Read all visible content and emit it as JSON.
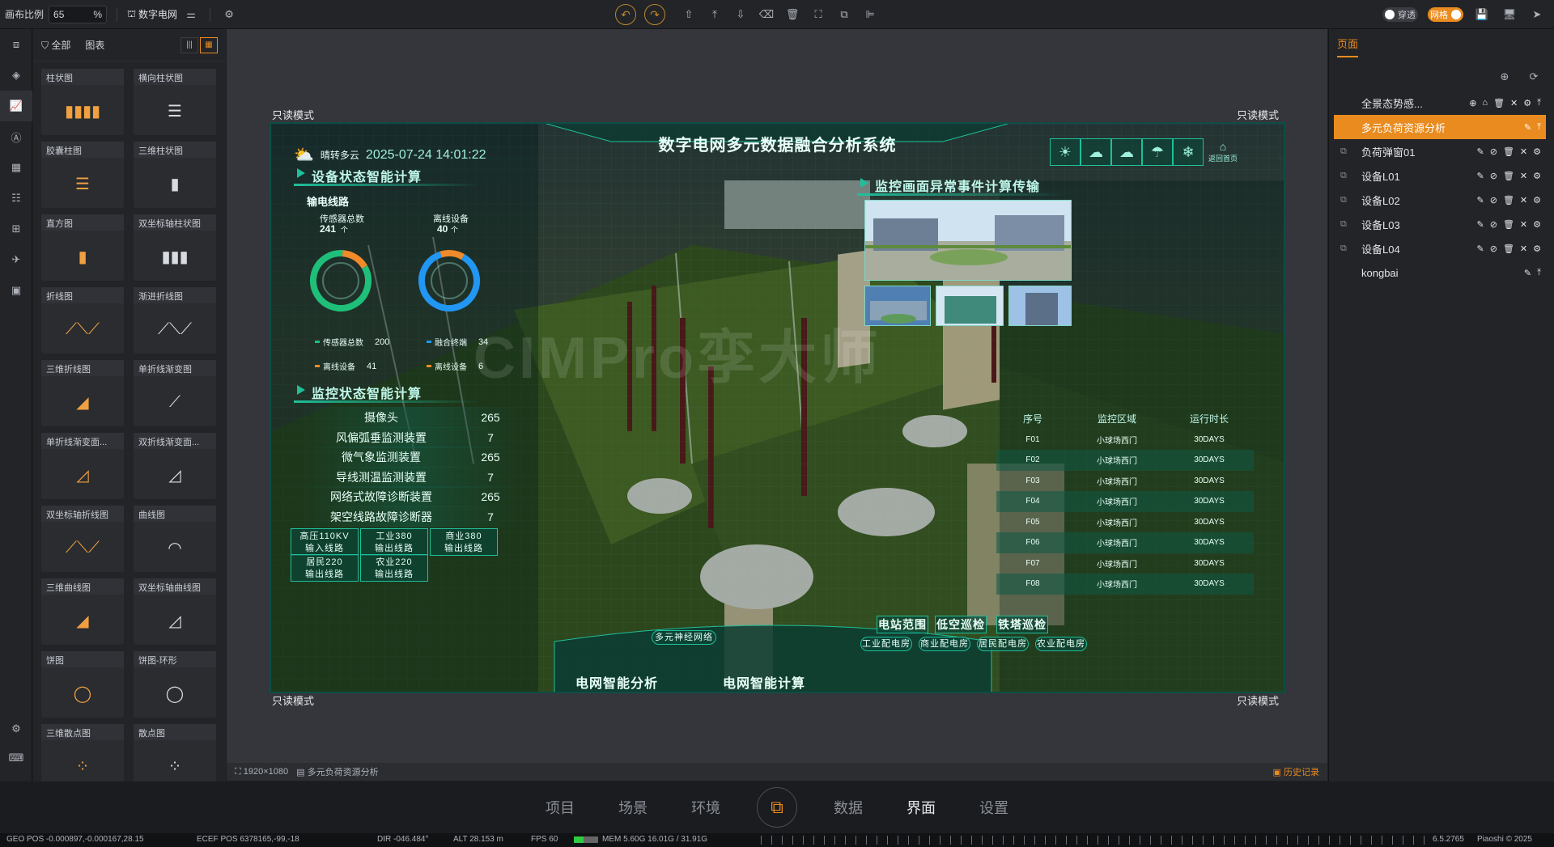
{
  "toolbar": {
    "zoom_label": "画布比例",
    "zoom_value": "65",
    "zoom_unit": "%",
    "project_name": "数字电网",
    "toggle_through": "穿透",
    "toggle_grid": "网格"
  },
  "library": {
    "tab_all": "全部",
    "tab_charts": "图表",
    "cards": [
      "柱状图",
      "横向柱状图",
      "胶囊柱图",
      "三维柱状图",
      "直方图",
      "双坐标轴柱状图",
      "折线图",
      "渐进折线图",
      "三维折线图",
      "单折线渐变图",
      "单折线渐变面...",
      "双折线渐变面...",
      "双坐标轴折线图",
      "曲线图",
      "三维曲线图",
      "双坐标轴曲线图",
      "饼图",
      "饼图-环形",
      "三维散点图",
      "散点图"
    ]
  },
  "stage": {
    "readonly": "只读模式",
    "footer_size": "1920×1080",
    "footer_page": "多元负荷资源分析",
    "history": "历史记录"
  },
  "dashboard": {
    "title": "数字电网多元数据融合分析系统",
    "weather": "晴转多云",
    "datetime": "2025-07-24 14:01:22",
    "sec1": "设备状态智能计算",
    "sub1": "输电线路",
    "sensor_label": "传感器总数",
    "sensor_value": "241",
    "sensor_unit": "个",
    "offline_label": "离线设备",
    "offline_value": "40",
    "offline_unit": "个",
    "legend": [
      {
        "label": "传感器总数",
        "value": "200",
        "color": "#1fbf7a"
      },
      {
        "label": "融合终端",
        "value": "34",
        "color": "#2196f3"
      },
      {
        "label": "离线设备",
        "value": "41",
        "color": "#f08a2a"
      },
      {
        "label": "离线设备",
        "value": "6",
        "color": "#f08a2a"
      }
    ],
    "sec2": "监控状态智能计算",
    "monitors": [
      {
        "name": "摄像头",
        "value": "265"
      },
      {
        "name": "风偏弧垂监测装置",
        "value": "7"
      },
      {
        "name": "微气象监测装置",
        "value": "265"
      },
      {
        "name": "导线测温监测装置",
        "value": "7"
      },
      {
        "name": "网络式故障诊断装置",
        "value": "265"
      },
      {
        "name": "架空线路故障诊断器",
        "value": "7"
      }
    ],
    "lines": [
      {
        "l1": "高压110KV",
        "l2": "输入线路"
      },
      {
        "l1": "工业380",
        "l2": "输出线路"
      },
      {
        "l1": "商业380",
        "l2": "输出线路"
      },
      {
        "l1": "居民220",
        "l2": "输出线路"
      },
      {
        "l1": "农业220",
        "l2": "输出线路"
      }
    ],
    "sec3": "监控画面异常事件计算传输",
    "table_headers": [
      "序号",
      "监控区域",
      "运行时长"
    ],
    "table_rows": [
      [
        "F01",
        "小球场西门",
        "30DAYS"
      ],
      [
        "F02",
        "小球场西门",
        "30DAYS"
      ],
      [
        "F03",
        "小球场西门",
        "30DAYS"
      ],
      [
        "F04",
        "小球场西门",
        "30DAYS"
      ],
      [
        "F05",
        "小球场西门",
        "30DAYS"
      ],
      [
        "F06",
        "小球场西门",
        "30DAYS"
      ],
      [
        "F07",
        "小球场西门",
        "30DAYS"
      ],
      [
        "F08",
        "小球场西门",
        "30DAYS"
      ]
    ],
    "patrols": [
      "电站范围",
      "低空巡检",
      "铁塔巡检"
    ],
    "rooms": [
      "工业配电房",
      "商业配电房",
      "居民配电房",
      "农业配电房"
    ],
    "neural": "多元神经网络",
    "bottom_left": "电网智能分析",
    "bottom_right": "电网智能计算",
    "back_home": "返回首页",
    "watermark": "CIMPro孪大师"
  },
  "pages": {
    "tab": "页面",
    "items": [
      {
        "name": "全景态势感...",
        "selected": false,
        "icon": false
      },
      {
        "name": "多元负荷资源分析",
        "selected": true,
        "icon": false
      },
      {
        "name": "负荷弹窗01",
        "selected": false,
        "icon": true
      },
      {
        "name": "设备L01",
        "selected": false,
        "icon": true
      },
      {
        "name": "设备L02",
        "selected": false,
        "icon": true
      },
      {
        "name": "设备L03",
        "selected": false,
        "icon": true
      },
      {
        "name": "设备L04",
        "selected": false,
        "icon": true
      },
      {
        "name": "kongbai",
        "selected": false,
        "icon": false
      }
    ]
  },
  "dock": [
    "项目",
    "场景",
    "环境",
    "数据",
    "界面",
    "设置"
  ],
  "status": {
    "geo": "GEO POS -0.000897,-0.000167,28.15",
    "ecef": "ECEF POS 6378165,-99,-18",
    "dir": "DIR  -046.484°",
    "alt": "ALT  28.153 m",
    "fps": "FPS  60",
    "mem": "MEM  5.60G  16.01G / 31.91G",
    "version": "6.5.2765",
    "brand": "Piaoshi © 2025"
  },
  "colors": {
    "accent": "#e98b1f",
    "teal": "#1fbf9a"
  }
}
